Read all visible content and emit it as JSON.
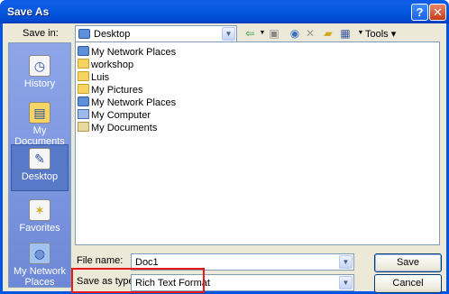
{
  "window": {
    "title": "Save As",
    "help_glyph": "?",
    "close_glyph": "✕"
  },
  "toolbar": {
    "save_in_label": "Save in:",
    "location_value": "Desktop",
    "tools_label": "Tools"
  },
  "places": [
    {
      "label": "History",
      "icon": "history-icon"
    },
    {
      "label": "My Documents",
      "icon": "my-documents-icon"
    },
    {
      "label": "Desktop",
      "icon": "desktop-icon",
      "selected": true
    },
    {
      "label": "Favorites",
      "icon": "favorites-icon"
    },
    {
      "label": "My Network Places",
      "icon": "network-places-icon"
    }
  ],
  "files": [
    {
      "label": "My Network Places",
      "icon": "network-icon"
    },
    {
      "label": "workshop",
      "icon": "folder-icon"
    },
    {
      "label": "Luis",
      "icon": "folder-icon"
    },
    {
      "label": "My Pictures",
      "icon": "folder-icon"
    },
    {
      "label": "My Network Places",
      "icon": "network-icon"
    },
    {
      "label": "My Computer",
      "icon": "computer-icon"
    },
    {
      "label": "My Documents",
      "icon": "documents-icon"
    }
  ],
  "form": {
    "file_name_label": "File name:",
    "file_name_value": "Doc1",
    "save_as_type_label": "Save as type:",
    "save_as_type_value": "Rich Text Format"
  },
  "buttons": {
    "save_label": "Save",
    "cancel_label": "Cancel"
  },
  "colors": {
    "highlight": "#e81818",
    "titlebar": "#0054e3"
  }
}
